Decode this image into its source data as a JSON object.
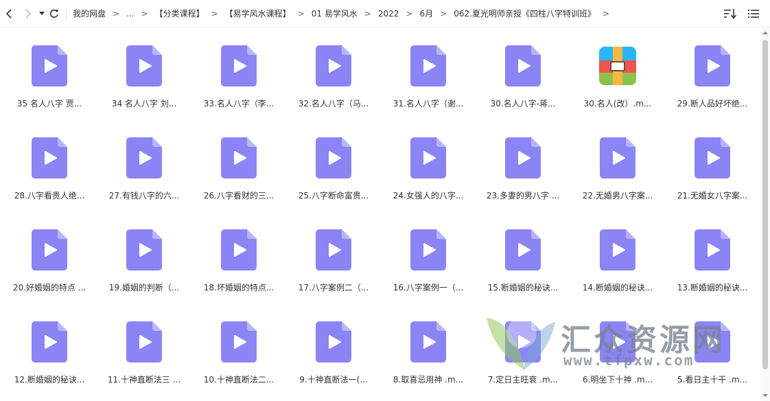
{
  "toolbar": {
    "breadcrumb": [
      "我的网盘",
      "...",
      "【分类课程】",
      "【易学风水课程】",
      "01 易学风水",
      "2022",
      "6月",
      "062.夏光明师亲授《四柱八字特训班》"
    ],
    "arrow": ">"
  },
  "files": [
    {
      "name": "35  名人八字 贾...",
      "type": "video"
    },
    {
      "name": "34 名人八字  刘...",
      "type": "video"
    },
    {
      "name": "33.名人八字（李...",
      "type": "video"
    },
    {
      "name": "32.名人八字（马...",
      "type": "video"
    },
    {
      "name": "31.名人八字（谢...",
      "type": "video"
    },
    {
      "name": "30.名人八字-蒋...",
      "type": "video"
    },
    {
      "name": "30.名人(改）.m...",
      "type": "archive"
    },
    {
      "name": "29.断人品好坏绝...",
      "type": "video"
    },
    {
      "name": "28.八字看贵人绝...",
      "type": "video"
    },
    {
      "name": "27.有钱八字的六...",
      "type": "video"
    },
    {
      "name": "26.八字看财的三...",
      "type": "video"
    },
    {
      "name": "25.八字断命富贵...",
      "type": "video"
    },
    {
      "name": "24.女强人的八字...",
      "type": "video"
    },
    {
      "name": "23.多妻的男八字 ...",
      "type": "video"
    },
    {
      "name": "22.无婚男八字案...",
      "type": "video"
    },
    {
      "name": "21.无婚女八字案...",
      "type": "video"
    },
    {
      "name": "20.好婚姻的特点 ...",
      "type": "video"
    },
    {
      "name": "19.婚姻的判断（...",
      "type": "video"
    },
    {
      "name": "18.坏婚姻的特点...",
      "type": "video"
    },
    {
      "name": "17.八字案例二（...",
      "type": "video"
    },
    {
      "name": "16.八字案例一（...",
      "type": "video"
    },
    {
      "name": "15.断婚姻的秘诀...",
      "type": "video"
    },
    {
      "name": "14.断婚姻的秘诀...",
      "type": "video"
    },
    {
      "name": "13.断婚姻的秘诀...",
      "type": "video"
    },
    {
      "name": "12.断婚姻的秘诀...",
      "type": "video"
    },
    {
      "name": "11.十神直断法三 ...",
      "type": "video"
    },
    {
      "name": "10.十神直断法二...",
      "type": "video"
    },
    {
      "name": "9.十神直断法一(...",
      "type": "video"
    },
    {
      "name": "8.取喜忌用神 .m...",
      "type": "video"
    },
    {
      "name": "7.定日主旺衰 .m...",
      "type": "video"
    },
    {
      "name": "6.明坐下十神 .m...",
      "type": "video"
    },
    {
      "name": "5.看日主十干 .m...",
      "type": "video"
    }
  ],
  "watermark": {
    "title": "汇众资源网",
    "url": "www.tfpxw.com"
  },
  "colors": {
    "video_icon": "#8b84f5",
    "video_icon_fold": "#b9b4fa"
  }
}
